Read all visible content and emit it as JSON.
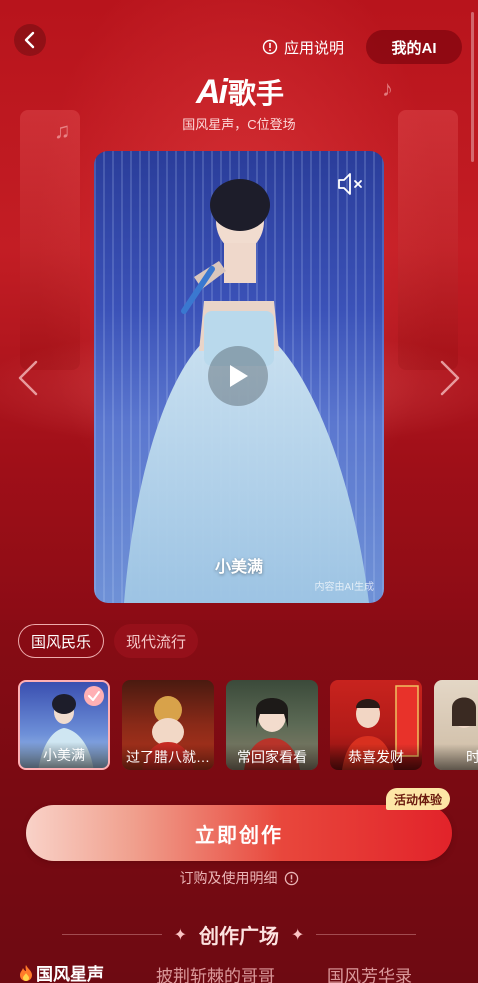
{
  "header": {
    "help_label": "应用说明",
    "my_ai_label": "我的AI"
  },
  "logo": {
    "ai_text": "Ai",
    "title_text": "歌手"
  },
  "tagline": "国风星声，C位登场",
  "player": {
    "singer_name": "小美满",
    "disclaimer": "内容由AI生成"
  },
  "tabs": [
    {
      "label": "国风民乐",
      "active": true
    },
    {
      "label": "现代流行",
      "active": false
    }
  ],
  "thumbnails": [
    {
      "label": "小美满",
      "selected": true
    },
    {
      "label": "过了腊八就…",
      "selected": false
    },
    {
      "label": "常回家看看",
      "selected": false
    },
    {
      "label": "恭喜发财",
      "selected": false
    },
    {
      "label": "时间",
      "selected": false
    }
  ],
  "create": {
    "button_label": "立即创作",
    "badge": "活动体验"
  },
  "usage_link": "订购及使用明细",
  "plaza_title": "创作广场",
  "bottom_tabs": [
    {
      "label": "国风星声",
      "active": true
    },
    {
      "label": "披荆斩棘的哥哥",
      "active": false
    },
    {
      "label": "国风芳华录",
      "active": false
    }
  ],
  "colors": {
    "background": "#8e0d16",
    "accent": "#e2232a",
    "badge": "#fde6a6"
  },
  "icons": [
    "back-icon",
    "info-icon",
    "music-note-icon",
    "mute-icon",
    "play-icon",
    "chevron-left-icon",
    "chevron-right-icon",
    "check-icon",
    "fire-icon",
    "sparkle-icon"
  ]
}
